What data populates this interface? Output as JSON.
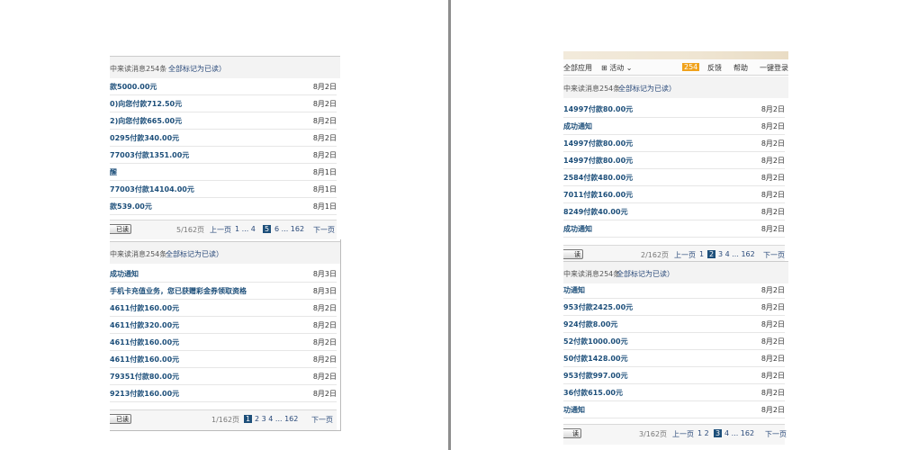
{
  "left": {
    "panel1": {
      "summary": "中来读消息254条",
      "markread": "全部标记为已读）",
      "rows": [
        {
          "subject": "款5000.00元",
          "date": "8月2日"
        },
        {
          "subject": "0)向您付款712.50元",
          "date": "8月2日"
        },
        {
          "subject": "2)向您付款665.00元",
          "date": "8月2日"
        },
        {
          "subject": "0295付款340.00元",
          "date": "8月2日"
        },
        {
          "subject": "77003付款1351.00元",
          "date": "8月2日"
        },
        {
          "subject": "醒",
          "date": "8月1日"
        },
        {
          "subject": "77003付款14104.00元",
          "date": "8月1日"
        },
        {
          "subject": "款539.00元",
          "date": "8月1日"
        }
      ],
      "pager": {
        "btn": "已读",
        "info": "5/162页",
        "prev": "上一页",
        "pages": "1 ... 4",
        "current": "5",
        "after": "6 ... 162",
        "next": "下一页"
      }
    },
    "panel2": {
      "summary": "中来读消息254条",
      "markread": "全部标记为已读）",
      "rows": [
        {
          "subject": "成功通知",
          "date": "8月3日"
        },
        {
          "subject": "手机卡充值业务，您已获赠彩金券领取资格",
          "date": "8月3日"
        },
        {
          "subject": "4611付款160.00元",
          "date": "8月2日"
        },
        {
          "subject": "4611付款320.00元",
          "date": "8月2日"
        },
        {
          "subject": "4611付款160.00元",
          "date": "8月2日"
        },
        {
          "subject": "4611付款160.00元",
          "date": "8月2日"
        },
        {
          "subject": "79351付款80.00元",
          "date": "8月2日"
        },
        {
          "subject": "9213付款160.00元",
          "date": "8月2日"
        }
      ],
      "pager": {
        "btn": "已读",
        "info": "1/162页",
        "current": "1",
        "after": "2 3 4 ... 162",
        "next": "下一页"
      }
    }
  },
  "right": {
    "menubar": {
      "apps": "全部应用",
      "activity": "⊞ 活动 ⌄",
      "badge": "254",
      "feedback": "反馈",
      "help": "帮助",
      "login": "一键登录"
    },
    "panel1": {
      "summary": "中来读消息254条",
      "markread": "全部标记为已读）",
      "rows": [
        {
          "subject": "14997付款80.00元",
          "date": "8月2日"
        },
        {
          "subject": "成功通知",
          "date": "8月2日"
        },
        {
          "subject": "14997付款80.00元",
          "date": "8月2日"
        },
        {
          "subject": "14997付款80.00元",
          "date": "8月2日"
        },
        {
          "subject": "2584付款480.00元",
          "date": "8月2日"
        },
        {
          "subject": "7011付款160.00元",
          "date": "8月2日"
        },
        {
          "subject": "8249付款40.00元",
          "date": "8月2日"
        },
        {
          "subject": "成功通知",
          "date": "8月2日"
        }
      ],
      "pager": {
        "btn": "读",
        "info": "2/162页",
        "prev": "上一页",
        "pages": "1",
        "current": "2",
        "after": "3 4 ... 162",
        "next": "下一页"
      }
    },
    "panel2": {
      "summary": "中来读消息254条",
      "markread": "全部标记为已读）",
      "rows": [
        {
          "subject": "功通知",
          "date": "8月2日"
        },
        {
          "subject": "953付款2425.00元",
          "date": "8月2日"
        },
        {
          "subject": "924付款8.00元",
          "date": "8月2日"
        },
        {
          "subject": "52付款1000.00元",
          "date": "8月2日"
        },
        {
          "subject": "50付款1428.00元",
          "date": "8月2日"
        },
        {
          "subject": "953付款997.00元",
          "date": "8月2日"
        },
        {
          "subject": "36付款615.00元",
          "date": "8月2日"
        },
        {
          "subject": "功通知",
          "date": "8月2日"
        }
      ],
      "pager": {
        "btn": "读",
        "info": "3/162页",
        "prev": "上一页",
        "pages": "1 2",
        "current": "3",
        "after": "4 ... 162",
        "next": "下一页"
      }
    }
  }
}
